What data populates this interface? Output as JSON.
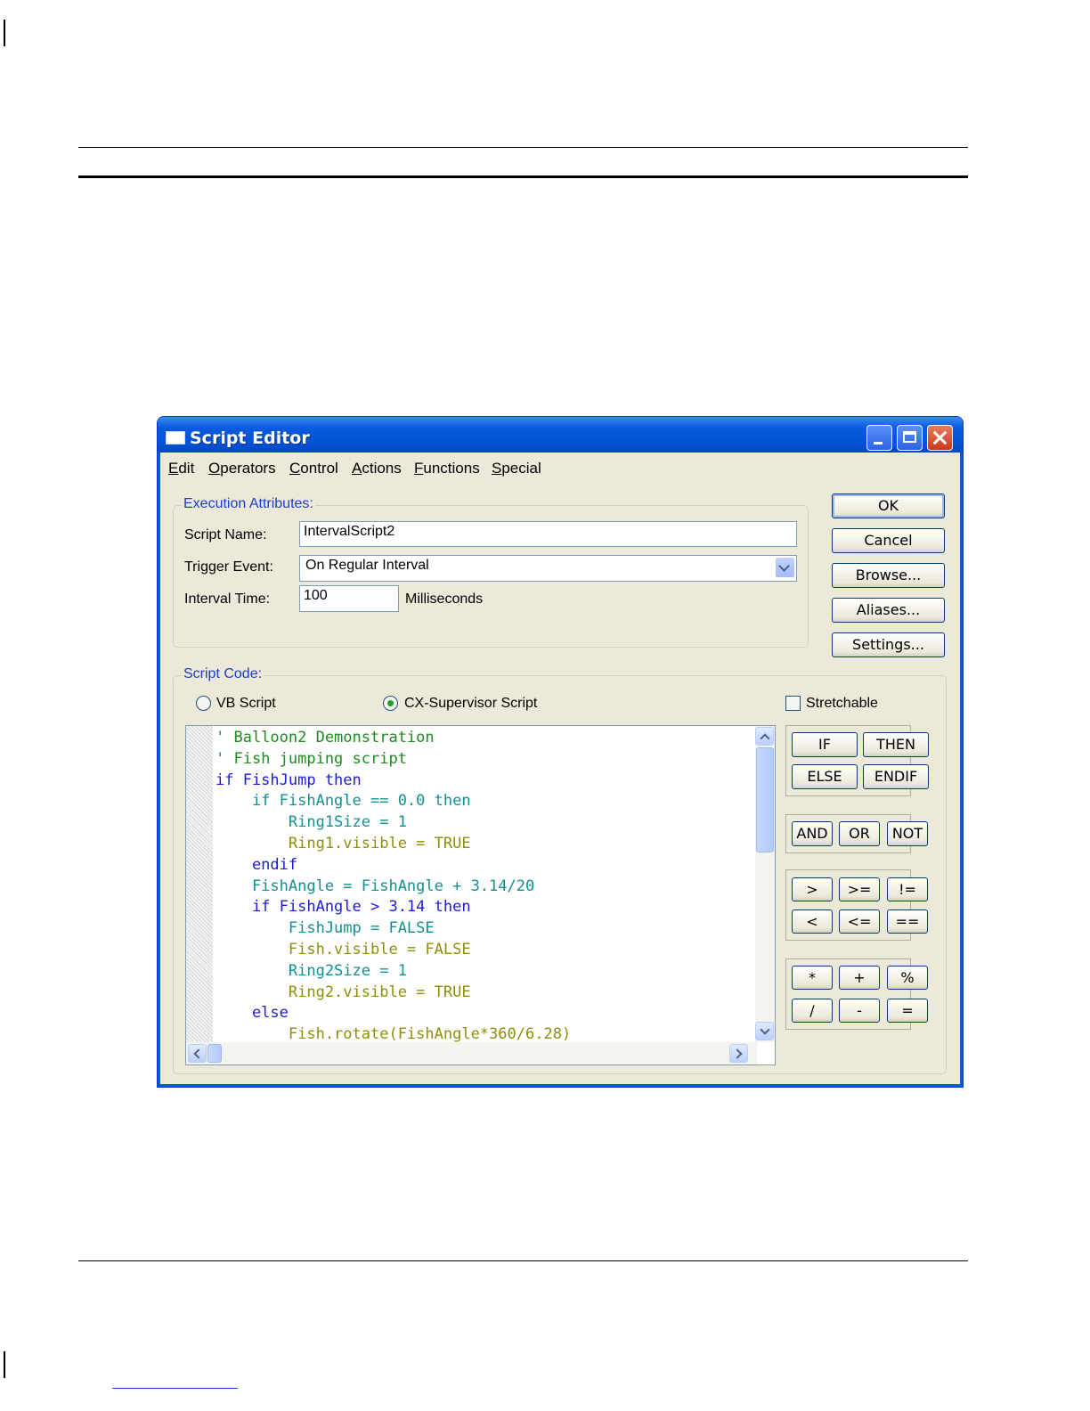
{
  "window": {
    "title": "Script Editor"
  },
  "menu": [
    "Edit",
    "Operators",
    "Control",
    "Actions",
    "Functions",
    "Special"
  ],
  "menu_underline": [
    "E",
    "O",
    "C",
    "A",
    "F",
    "S"
  ],
  "execution": {
    "group_label": "Execution Attributes:",
    "script_name_label": "Script Name:",
    "script_name_value": "IntervalScript2",
    "trigger_label": "Trigger Event:",
    "trigger_value": "On Regular Interval",
    "interval_label": "Interval Time:",
    "interval_value": "100",
    "interval_unit": "Milliseconds"
  },
  "buttons": {
    "ok": "OK",
    "cancel": "Cancel",
    "browse": "Browse...",
    "aliases": "Aliases...",
    "settings": "Settings..."
  },
  "script_code": {
    "group_label": "Script Code:",
    "radio_vb": "VB Script",
    "radio_cx": "CX-Supervisor Script",
    "radio_selected": "CX-Supervisor Script",
    "stretchable": "Stretchable",
    "stretchable_checked": false
  },
  "code_lines": [
    "' Balloon2 Demonstration",
    "' Fish jumping script",
    "if FishJump then",
    "    if FishAngle == 0.0 then",
    "        Ring1Size = 1",
    "        Ring1.visible = TRUE",
    "    endif",
    "    FishAngle = FishAngle + 3.14/20",
    "    if FishAngle > 3.14 then",
    "        FishJump = FALSE",
    "        Fish.visible = FALSE",
    "        Ring2Size = 1",
    "        Ring2.visible = TRUE",
    "    else",
    "        Fish.rotate(FishAngle*360/6.28)"
  ],
  "operators": {
    "control": [
      "IF",
      "THEN",
      "ELSE",
      "ENDIF"
    ],
    "logical": [
      "AND",
      "OR",
      "NOT"
    ],
    "comparison": [
      ">",
      ">=",
      "!=",
      "<",
      "<=",
      "=="
    ],
    "arithmetic": [
      "*",
      "+",
      "%",
      "/",
      "-",
      "="
    ]
  }
}
